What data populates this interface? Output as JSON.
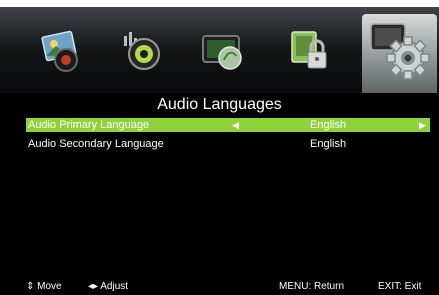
{
  "menu": {
    "icons": [
      {
        "name": "picture-icon"
      },
      {
        "name": "sound-icon"
      },
      {
        "name": "channel-icon"
      },
      {
        "name": "lock-icon"
      },
      {
        "name": "setup-icon",
        "selected": true
      }
    ]
  },
  "page": {
    "title": "Audio Languages"
  },
  "rows": [
    {
      "label": "Audio Primary Language",
      "value": "English",
      "selected": true,
      "left_arrow": "◀",
      "right_arrow": "▶"
    },
    {
      "label": "Audio Secondary Language",
      "value": "English",
      "selected": false
    }
  ],
  "footer": {
    "move_label": "⇕ Move",
    "adjust_label": "◂▸ Adjust",
    "return_label": "MENU: Return",
    "exit_label": "EXIT: Exit"
  },
  "colors": {
    "highlight": "#8fd33b",
    "background": "#000000"
  }
}
